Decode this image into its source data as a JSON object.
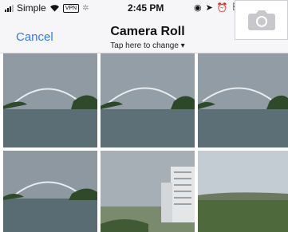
{
  "status": {
    "carrier": "Simple",
    "vpn": "VPN",
    "time": "2:45 PM"
  },
  "nav": {
    "cancel_label": "Cancel",
    "title": "Camera Roll",
    "subtitle": "Tap here to change ▾"
  },
  "icons": {
    "camera": "camera-icon",
    "wifi": "wifi-icon",
    "location": "location-arrow-icon",
    "alarm": "alarm-icon",
    "bluetooth": "bluetooth-icon",
    "lock": "rotation-lock-icon"
  },
  "colors": {
    "accent": "#3478f6",
    "navbar_bg": "#f6f6f8"
  },
  "photos": [
    {
      "kind": "bridge"
    },
    {
      "kind": "bridge"
    },
    {
      "kind": "bridge"
    },
    {
      "kind": "bridge"
    },
    {
      "kind": "building"
    },
    {
      "kind": "field"
    }
  ]
}
